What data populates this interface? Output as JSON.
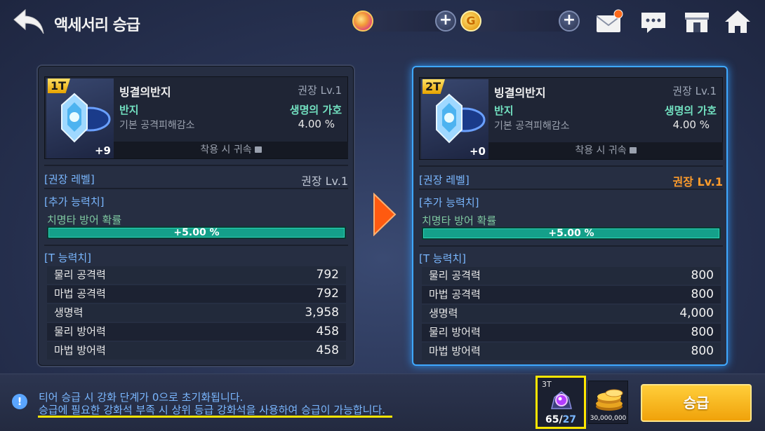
{
  "header": {
    "title": "액세서리 승급",
    "gold_symbol": "G",
    "plus_symbol": "+"
  },
  "panels": [
    {
      "tier": "1T",
      "enhance": "+9",
      "item_name": "빙결의반지",
      "item_req": "권장 Lv.1",
      "item_type": "반지",
      "item_set": "생명의 가호",
      "item_option": "기본 공격피해감소",
      "item_option_value": "4.00 %",
      "bind_text": "착용 시 귀속",
      "level_head": "[권장 레벨]",
      "level_value": "권장 Lv.1",
      "extra_head": "[추가 능력치]",
      "extra_label": "치명타 방어 확률",
      "extra_value": "+5.00 %",
      "t_head": "[T 능력치]",
      "stats": [
        {
          "label": "물리 공격력",
          "value": "792"
        },
        {
          "label": "마법 공격력",
          "value": "792"
        },
        {
          "label": "생명력",
          "value": "3,958"
        },
        {
          "label": "물리 방어력",
          "value": "458"
        },
        {
          "label": "마법 방어력",
          "value": "458"
        }
      ]
    },
    {
      "tier": "2T",
      "enhance": "+0",
      "item_name": "빙결의반지",
      "item_req": "권장 Lv.1",
      "item_type": "반지",
      "item_set": "생명의 가호",
      "item_option": "기본 공격피해감소",
      "item_option_value": "4.00 %",
      "bind_text": "착용 시 귀속",
      "level_head": "[권장 레벨]",
      "level_value": "권장 Lv.1",
      "extra_head": "[추가 능력치]",
      "extra_label": "치명타 방어 확률",
      "extra_value": "+5.00 %",
      "t_head": "[T 능력치]",
      "stats": [
        {
          "label": "물리 공격력",
          "value": "800"
        },
        {
          "label": "마법 공격력",
          "value": "800"
        },
        {
          "label": "생명력",
          "value": "4,000"
        },
        {
          "label": "물리 방어력",
          "value": "800"
        },
        {
          "label": "마법 방어력",
          "value": "800"
        }
      ]
    }
  ],
  "footer": {
    "info_symbol": "!",
    "notice_line1": "티어 승급 시 강화 단계가 0으로 초기화됩니다.",
    "notice_line2": "승급에 필요한 강화석 부족 시 상위 등급 강화석을 사용하여 승급이 가능합니다.",
    "material_tier": "3T",
    "material_have": "65",
    "material_sep": "/",
    "material_need": "27",
    "gold_cost": "30,000,000",
    "upgrade_label": "승급"
  },
  "colors": {
    "accent_blue": "#3fa8ff",
    "highlight_orange": "#ff9c2b",
    "button_gold": "#f0a20a",
    "notice_underline": "#ffe600"
  }
}
